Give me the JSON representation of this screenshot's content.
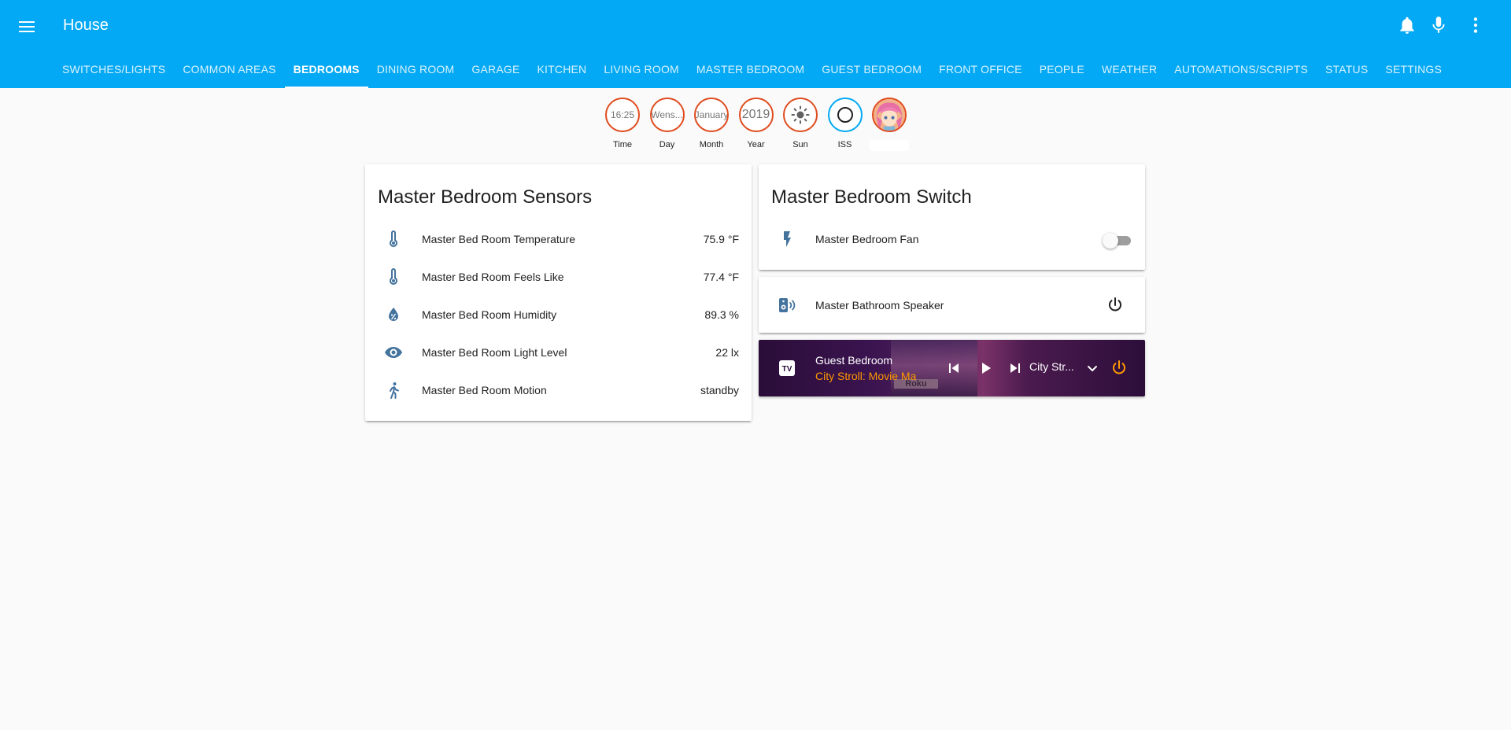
{
  "header": {
    "title": "House"
  },
  "tabs": [
    {
      "label": "SWITCHES/LIGHTS"
    },
    {
      "label": "COMMON AREAS"
    },
    {
      "label": "BEDROOMS",
      "active": true
    },
    {
      "label": "DINING ROOM"
    },
    {
      "label": "GARAGE"
    },
    {
      "label": "KITCHEN"
    },
    {
      "label": "LIVING ROOM"
    },
    {
      "label": "MASTER BEDROOM"
    },
    {
      "label": "GUEST BEDROOM"
    },
    {
      "label": "FRONT OFFICE"
    },
    {
      "label": "PEOPLE"
    },
    {
      "label": "WEATHER"
    },
    {
      "label": "AUTOMATIONS/SCRIPTS"
    },
    {
      "label": "STATUS"
    },
    {
      "label": "SETTINGS"
    }
  ],
  "badges": [
    {
      "value": "16:25",
      "label": "Time"
    },
    {
      "value": "Wens...",
      "label": "Day"
    },
    {
      "value": "January",
      "label": "Month"
    },
    {
      "value": "2019",
      "label": "Year"
    },
    {
      "icon": "sun-icon",
      "label": "Sun"
    },
    {
      "icon": "circle-outline-icon",
      "label": "ISS"
    },
    {
      "icon": "person-avatar",
      "label": ""
    }
  ],
  "sensors_card": {
    "title": "Master Bedroom Sensors",
    "rows": [
      {
        "icon": "thermometer-icon",
        "label": "Master Bed Room Temperature",
        "value": "75.9 °F"
      },
      {
        "icon": "thermometer-icon",
        "label": "Master Bed Room Feels Like",
        "value": "77.4 °F"
      },
      {
        "icon": "water-percent-icon",
        "label": "Master Bed Room Humidity",
        "value": "89.3 %"
      },
      {
        "icon": "eye-icon",
        "label": "Master Bed Room Light Level",
        "value": "22 lx"
      },
      {
        "icon": "walk-icon",
        "label": "Master Bed Room Motion",
        "value": "standby"
      }
    ]
  },
  "switch_card": {
    "title": "Master Bedroom Switch",
    "rows": [
      {
        "icon": "flash-icon",
        "label": "Master Bedroom Fan",
        "state": "off"
      }
    ]
  },
  "speaker_card": {
    "icon": "speaker-icon",
    "label": "Master Bathroom Speaker"
  },
  "media_card": {
    "title": "Guest Bedroom",
    "now_playing": "City Stroll: Movie Ma",
    "source": "City Str...",
    "art_text": "Roku"
  },
  "colors": {
    "primary": "#03a9f4",
    "icon": "#44739e",
    "badge_border": "#df4c1e",
    "media_accent": "#ff9800"
  }
}
